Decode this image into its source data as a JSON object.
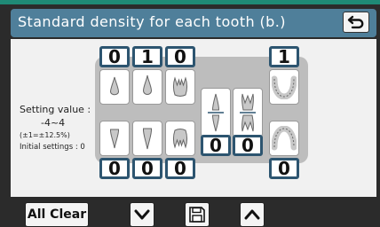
{
  "header": {
    "title": "Standard density for each tooth (b.)"
  },
  "setting_info": {
    "label": "Setting value :",
    "range": "-4~4",
    "step_note": "(±1=±12.5%)",
    "initial": "Initial settings : 0"
  },
  "upper_values": [
    "0",
    "1",
    "0"
  ],
  "upper_arch_value": "1",
  "lower_values": [
    "0",
    "0",
    "0"
  ],
  "middle_values": [
    "0",
    "0"
  ],
  "lower_arch_value": "0",
  "footer": {
    "clear_label": "All Clear"
  },
  "icons": {
    "back": "return-arrow-icon",
    "down": "chevron-down-icon",
    "save": "floppy-disk-icon",
    "up": "chevron-up-icon"
  },
  "colors": {
    "header_bg": "#4f7f9a",
    "value_border": "#2d5570",
    "tooth_fill": "#c8c8c8",
    "accent_top": "#1f8a76"
  }
}
